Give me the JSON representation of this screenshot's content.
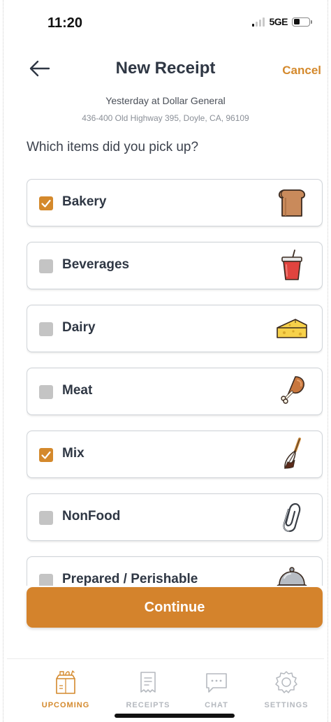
{
  "status_bar": {
    "time": "11:20",
    "network": "5GE"
  },
  "header": {
    "title": "New Receipt",
    "cancel_label": "Cancel"
  },
  "receipt": {
    "when_where": "Yesterday at Dollar General",
    "address": "436-400 Old Highway 395, Doyle, CA, 96109"
  },
  "question": "Which items did you pick up?",
  "categories": [
    {
      "label": "Bakery",
      "checked": true,
      "icon": "bread-icon"
    },
    {
      "label": "Beverages",
      "checked": false,
      "icon": "drink-cup-icon"
    },
    {
      "label": "Dairy",
      "checked": false,
      "icon": "cheese-icon"
    },
    {
      "label": "Meat",
      "checked": false,
      "icon": "drumstick-icon"
    },
    {
      "label": "Mix",
      "checked": true,
      "icon": "whisk-icon"
    },
    {
      "label": "NonFood",
      "checked": false,
      "icon": "paperclip-icon"
    },
    {
      "label": "Prepared / Perishable",
      "checked": false,
      "icon": "cloche-icon"
    }
  ],
  "continue_label": "Continue",
  "nav": {
    "items": [
      {
        "label": "UPCOMING",
        "icon": "grocery-bag-icon",
        "active": true
      },
      {
        "label": "RECEIPTS",
        "icon": "receipt-icon",
        "active": false
      },
      {
        "label": "CHAT",
        "icon": "chat-icon",
        "active": false
      },
      {
        "label": "SETTINGS",
        "icon": "gear-icon",
        "active": false
      }
    ]
  },
  "colors": {
    "accent": "#d4892c",
    "checkbox_unchecked": "#c4c4c4",
    "nav_inactive": "#b5b9bf"
  }
}
